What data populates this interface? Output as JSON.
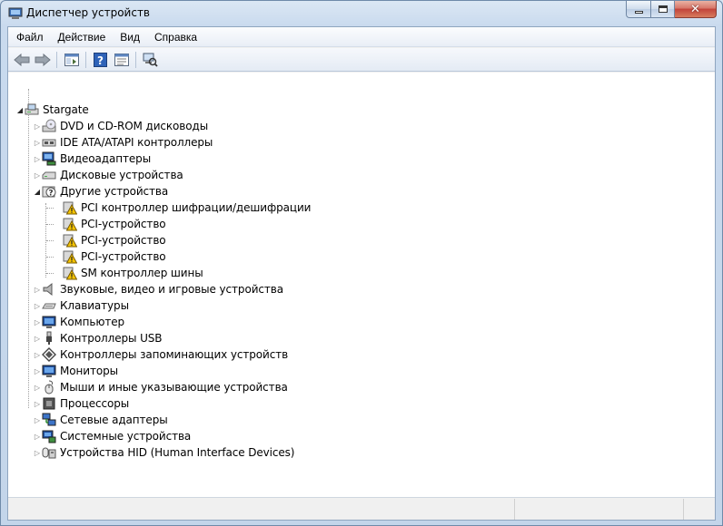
{
  "window": {
    "title": "Диспетчер устройств"
  },
  "menu": [
    {
      "label": "Файл"
    },
    {
      "label": "Действие"
    },
    {
      "label": "Вид"
    },
    {
      "label": "Справка"
    }
  ],
  "toolbar": {
    "buttons": [
      "back-arrow-icon",
      "forward-arrow-icon",
      "properties-icon",
      "help-icon",
      "view-icon",
      "scan-hardware-icon"
    ]
  },
  "tree": {
    "root": {
      "label": "Stargate",
      "expanded": true,
      "icon": "computer-icon"
    },
    "categories": [
      {
        "label": "DVD и CD-ROM дисководы",
        "icon": "dvd-drive-icon",
        "expanded": false
      },
      {
        "label": "IDE ATA/ATAPI контроллеры",
        "icon": "ide-controller-icon",
        "expanded": false
      },
      {
        "label": "Видеоадаптеры",
        "icon": "display-adapter-icon",
        "expanded": false
      },
      {
        "label": "Дисковые устройства",
        "icon": "disk-drive-icon",
        "expanded": false
      },
      {
        "label": "Другие устройства",
        "icon": "unknown-device-icon",
        "expanded": true,
        "children": [
          {
            "label": "PCI контроллер шифрации/дешифрации",
            "icon": "warning-device-icon"
          },
          {
            "label": "PCI-устройство",
            "icon": "warning-device-icon"
          },
          {
            "label": "PCI-устройство",
            "icon": "warning-device-icon"
          },
          {
            "label": "PCI-устройство",
            "icon": "warning-device-icon"
          },
          {
            "label": "SM контроллер шины",
            "icon": "warning-device-icon"
          }
        ]
      },
      {
        "label": "Звуковые, видео и игровые устройства",
        "icon": "speaker-icon",
        "expanded": false
      },
      {
        "label": "Клавиатуры",
        "icon": "keyboard-icon",
        "expanded": false
      },
      {
        "label": "Компьютер",
        "icon": "computer-monitor-icon",
        "expanded": false
      },
      {
        "label": "Контроллеры USB",
        "icon": "usb-icon",
        "expanded": false
      },
      {
        "label": "Контроллеры запоминающих устройств",
        "icon": "storage-controller-icon",
        "expanded": false
      },
      {
        "label": "Мониторы",
        "icon": "monitor-icon",
        "expanded": false
      },
      {
        "label": "Мыши и иные указывающие устройства",
        "icon": "mouse-icon",
        "expanded": false
      },
      {
        "label": "Процессоры",
        "icon": "processor-icon",
        "expanded": false
      },
      {
        "label": "Сетевые адаптеры",
        "icon": "network-adapter-icon",
        "expanded": false
      },
      {
        "label": "Системные устройства",
        "icon": "system-device-icon",
        "expanded": false
      },
      {
        "label": "Устройства HID (Human Interface Devices)",
        "icon": "hid-icon",
        "expanded": false
      }
    ]
  },
  "colors": {
    "titlebar": "#c9daee",
    "tree_background": "#ffffff",
    "warning": "#f5c400",
    "close_button": "#c2443b"
  }
}
